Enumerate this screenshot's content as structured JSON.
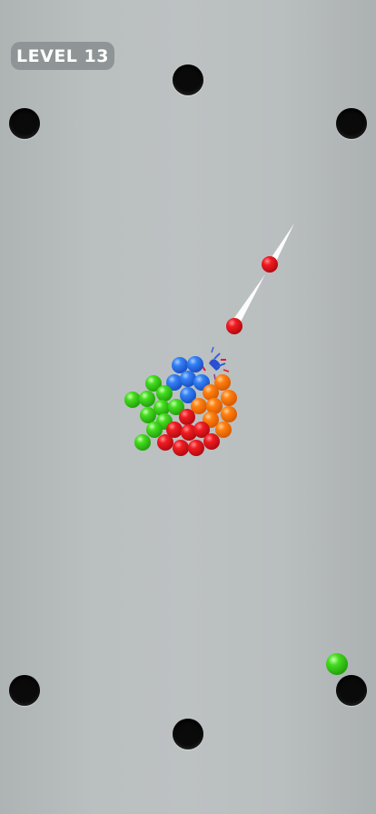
{
  "hud": {
    "level_label": "LEVEL 13"
  },
  "colors": {
    "table": "#b9bebf",
    "red": "#e8141c",
    "green": "#3fd81e",
    "blue": "#2f78f0",
    "orange": "#ff7a0a",
    "pocket": "#0b0b0b"
  },
  "pockets": [
    "top-center",
    "top-left",
    "top-right",
    "bottom-left",
    "bottom-center",
    "bottom-right"
  ],
  "balls": {
    "cue_ball_color": "green",
    "moving_balls": [
      "red",
      "red"
    ],
    "cluster": [
      "red",
      "green",
      "blue",
      "orange"
    ]
  }
}
